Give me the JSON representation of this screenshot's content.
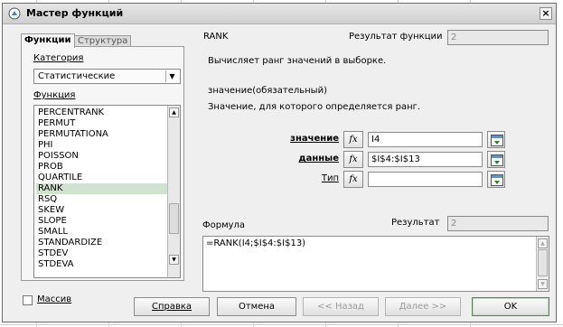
{
  "window": {
    "title": "Мастер функций",
    "close_glyph": "×"
  },
  "tabs": [
    {
      "label": "Функции",
      "active": true
    },
    {
      "label": "Структура",
      "active": false
    }
  ],
  "left": {
    "category_label": "Категория",
    "category_value": "Статистические",
    "function_label": "Функция",
    "functions": [
      "PERCENTRANK",
      "PERMUT",
      "PERMUTATIONA",
      "PHI",
      "POISSON",
      "PROB",
      "QUARTILE",
      "RANK",
      "RSQ",
      "SKEW",
      "SLOPE",
      "SMALL",
      "STANDARDIZE",
      "STDEV",
      "STDEVA"
    ],
    "selected_function": "RANK",
    "array_label": "Массив"
  },
  "right": {
    "function_name": "RANK",
    "result_label": "Результат функции",
    "result_value": "2",
    "description": "Вычисляет ранг значений в выборке.",
    "param_heading": "значение(обязательный)",
    "param_description": "Значение, для которого определяется ранг.",
    "args": [
      {
        "label": "значение",
        "value": "I4",
        "fx": "fx"
      },
      {
        "label": "данные",
        "value": "$I$4:$I$13",
        "fx": "fx"
      },
      {
        "label": "Тип",
        "value": "",
        "fx": "fx"
      }
    ],
    "formula_label": "Формула",
    "formula_result_label": "Результат",
    "formula_result_value": "2",
    "formula_text": "=RANK(I4;$I$4:$I$13)"
  },
  "buttons": {
    "help": "Справка",
    "cancel": "Отмена",
    "back": "<< Назад",
    "next": "Далее >>",
    "ok": "OK"
  },
  "colors": {
    "dialog_bg": "#efefef",
    "selection": "#cfe3cf"
  }
}
